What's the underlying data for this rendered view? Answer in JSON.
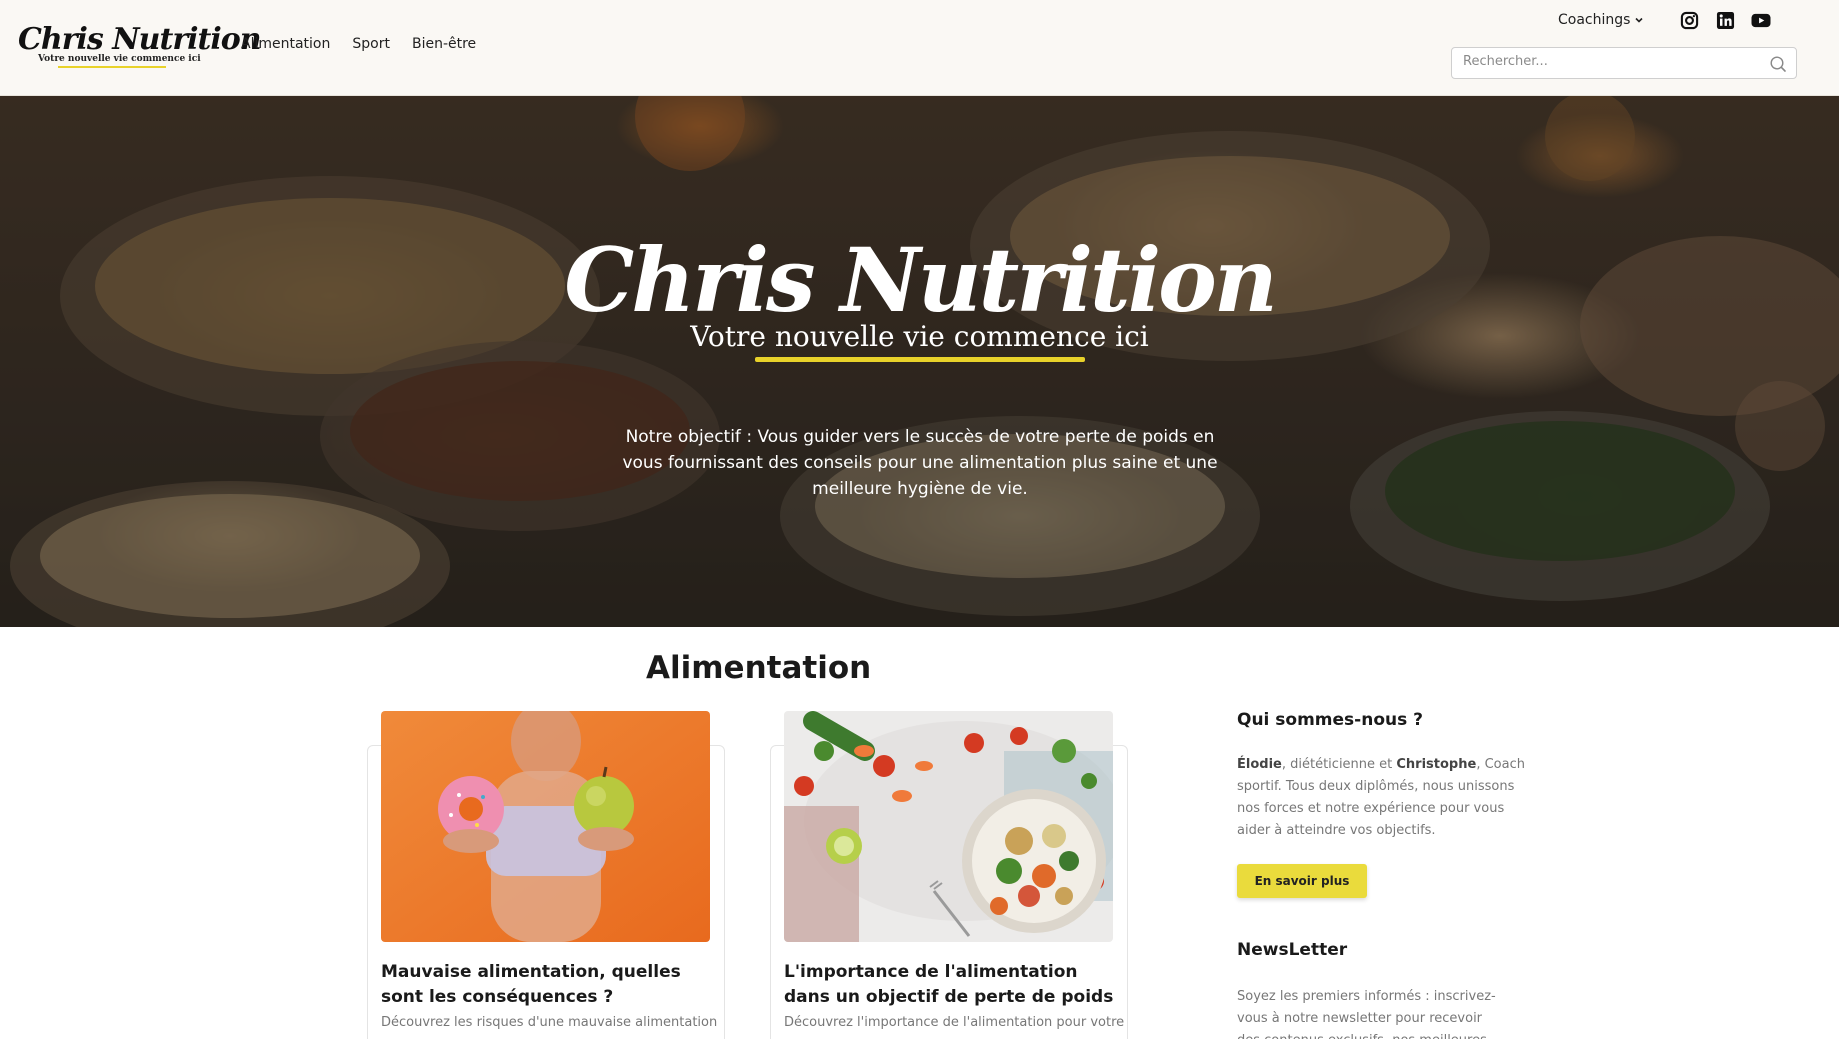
{
  "header": {
    "logo_title": "Chris Nutrition",
    "logo_subtitle": "Votre nouvelle vie commence ici",
    "nav": [
      "Alimentation",
      "Sport",
      "Bien-être"
    ],
    "coachings_label": "Coachings",
    "social_icons": [
      "instagram-icon",
      "linkedin-icon",
      "youtube-icon"
    ],
    "search_placeholder": "Rechercher..."
  },
  "hero": {
    "title": "Chris Nutrition",
    "subtitle": "Votre nouvelle vie commence ici",
    "text": "Notre objectif : Vous guider vers le succès de votre perte de poids en vous fournissant des conseils pour une alimentation plus saine et une meilleure hygiène de vie.",
    "accent_color": "#e8d22a"
  },
  "main": {
    "section_title": "Alimentation",
    "cards": [
      {
        "title": "Mauvaise alimentation, quelles sont les conséquences ?",
        "excerpt": "Découvrez les risques d'une mauvaise alimentation"
      },
      {
        "title": "L'importance de l'alimentation dans un objectif de perte de poids",
        "excerpt": "Découvrez l'importance de l'alimentation pour votre"
      }
    ]
  },
  "sidebar": {
    "about_title": "Qui sommes-nous ?",
    "about_name1": "Élodie",
    "about_text1": ", diététicienne et ",
    "about_name2": "Christophe",
    "about_text2": ", Coach sportif. Tous deux diplômés, nous unissons nos forces et notre expérience pour vous aider à atteindre vos objectifs.",
    "about_button": "En savoir plus",
    "newsletter_title": "NewsLetter",
    "newsletter_text": "Soyez les premiers informés : inscrivez-vous à notre newsletter pour recevoir des contenus exclusifs, nos meilleures"
  }
}
